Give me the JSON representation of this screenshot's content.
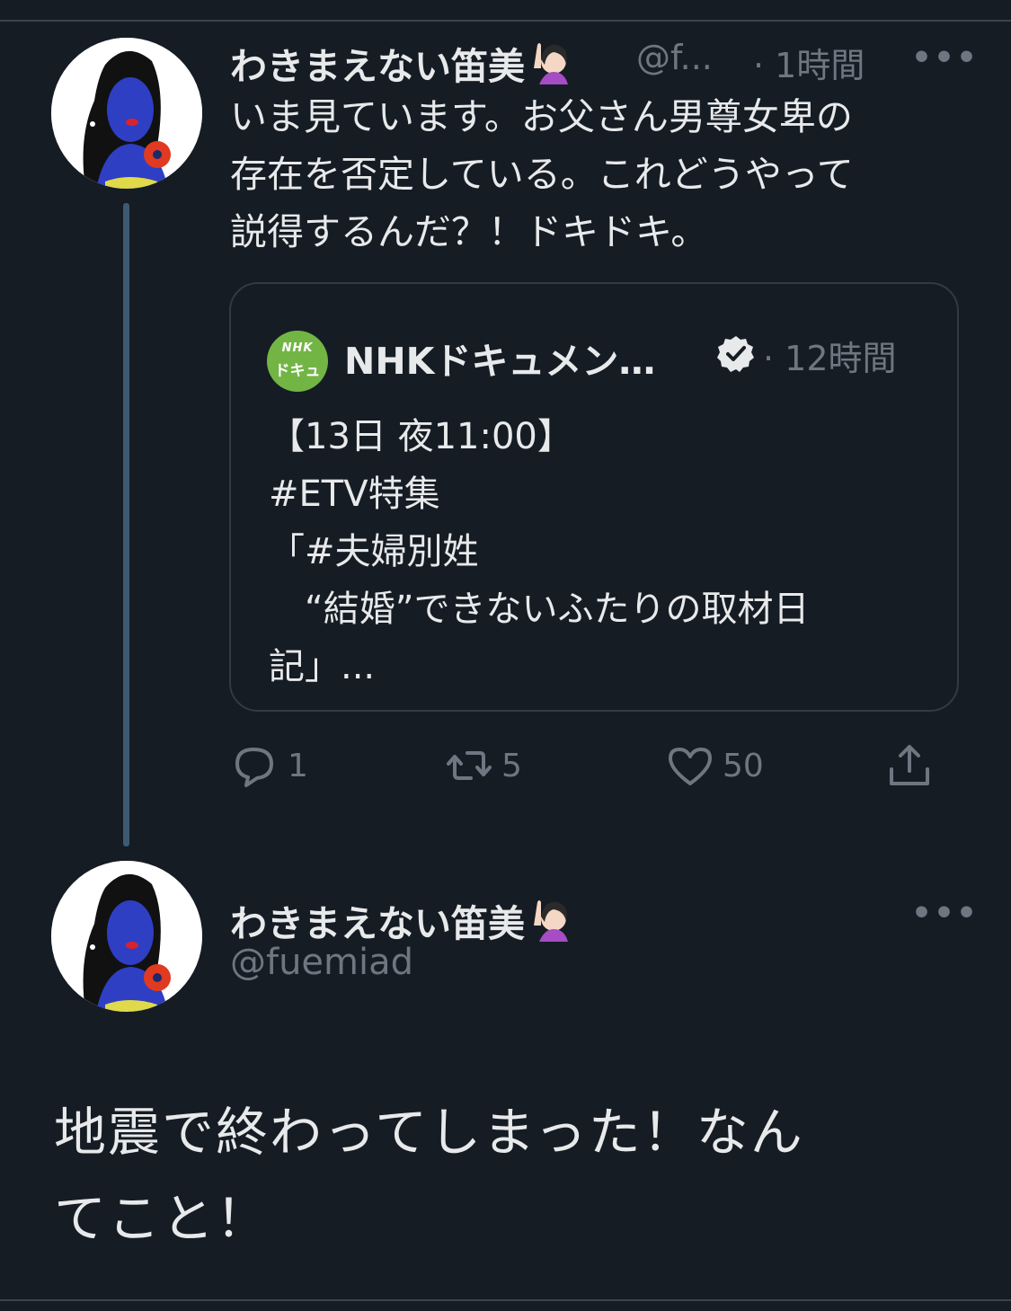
{
  "thread": {
    "tweet1": {
      "author_name": "わきまえない笛美",
      "handle": "@f...",
      "time": "· 1時間",
      "more": "•••",
      "lines": [
        "いま見ています。お父さん男尊女卑の",
        "存在を否定している。これどうやって",
        "説得するんだ？！ドキドキ。"
      ],
      "quoted": {
        "logo_line1": "NHK",
        "logo_line2": "ドキュ",
        "author_name": "NHKドキュメン…",
        "time": "· 12時間",
        "lines": [
          "【13日 夜11:00】",
          "#ETV特集",
          "「#夫婦別姓",
          "　“結婚”できないふたりの取材日",
          "記」..."
        ]
      },
      "actions": {
        "reply_count": "1",
        "retweet_count": "5",
        "like_count": "50"
      }
    },
    "tweet2": {
      "author_name": "わきまえない笛美",
      "handle": "@fuemiad",
      "more": "•••",
      "lines": [
        "地震で終わってしまった！なん",
        "てこと！"
      ]
    }
  },
  "colors": {
    "background": "#161c24",
    "text": "#e7e9ea",
    "muted": "#6e7781",
    "thread_line": "#3e5a73",
    "nhk_green": "#72b544"
  },
  "icons": {
    "reply": "speech-bubble-icon",
    "retweet": "retweet-icon",
    "like": "heart-icon",
    "share": "share-icon",
    "verified": "verified-badge-icon",
    "emoji": "person-raising-hand-emoji"
  }
}
